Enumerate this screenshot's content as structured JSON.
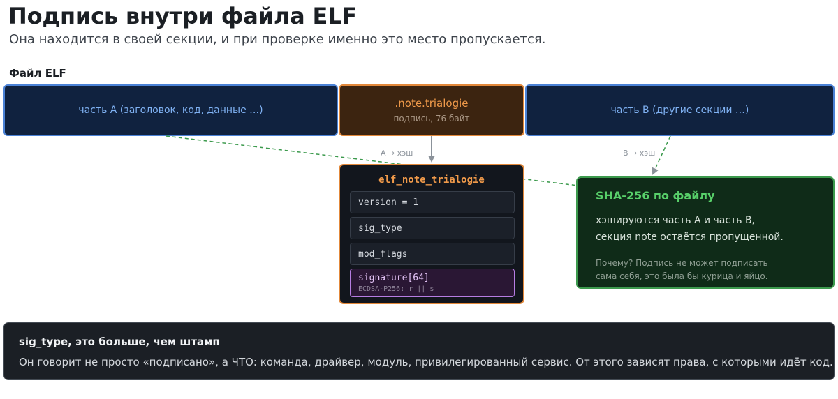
{
  "header": {
    "title": "Подпись внутри файла ELF",
    "subtitle": "Она находится в своей секции, и при проверке именно это место пропускается."
  },
  "file": {
    "label": "Файл ELF",
    "part_a": "часть A (заголовок, код, данные …)",
    "note_name": ".note.trialogie",
    "note_sub": "подпись, 76 байт",
    "part_b": "часть B (другие секции …)"
  },
  "edges": {
    "a_hash": "A → хэш",
    "b_hash": "B → хэш"
  },
  "struct": {
    "title": "elf_note_trialogie",
    "fields": [
      "version = 1",
      "sig_type",
      "mod_flags"
    ],
    "signature": "signature[64]",
    "signature_sub": "ECDSA-P256: r || s"
  },
  "sha": {
    "title": "SHA-256 по файлу",
    "line1": "хэшируются часть A и часть B,",
    "line2": "секция note остаётся пропущенной.",
    "note1": "Почему? Подпись не может подписать",
    "note2": "сама себя, это была бы курица и яйцо."
  },
  "callout": {
    "title": "sig_type, это больше, чем штамп",
    "body": "Он говорит не просто «подписано», а ЧТО: команда, драйвер, модуль, привилегированный сервис. От этого зависят права, с которыми идёт код."
  },
  "colors": {
    "part_fill": "#10223f",
    "part_border": "#4b82d6",
    "note_fill": "#3c2410",
    "note_border": "#e2883a",
    "sha_fill": "#0f2b18",
    "sha_border": "#3c9a4d",
    "signature_border": "#b67de2"
  }
}
